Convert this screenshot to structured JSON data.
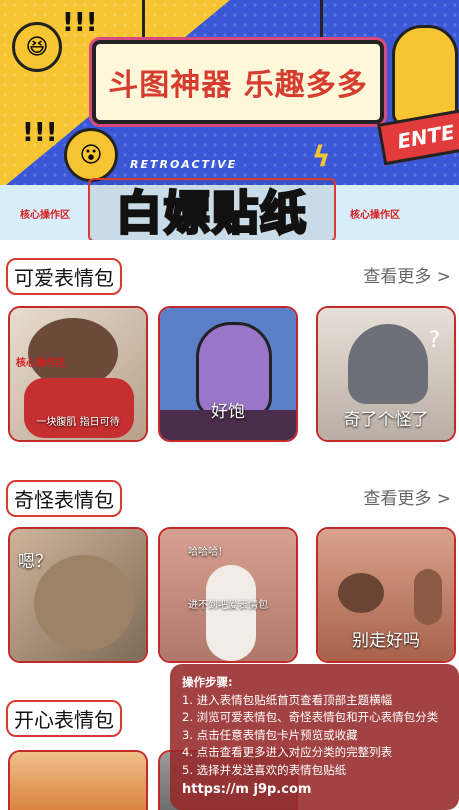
{
  "banner": {
    "sign_text": "斗图神器 乐趣多多",
    "retro_text": "RETROACTIVE",
    "enter_text": "ENTE",
    "bang_top": "!!!",
    "bang_left": "!!!",
    "hero_title": "白嫖贴纸",
    "core_label_left": "核心操作区",
    "core_label_right": "核心操作区"
  },
  "sections": [
    {
      "title": "可爱表情包",
      "more": "查看更多 >",
      "cards": [
        {
          "caption": "一块腹肌 指日可待",
          "overlay": "核心操作区",
          "bg": "#c9b8a8"
        },
        {
          "caption": "好饱",
          "bg": "#5b7fc9"
        },
        {
          "caption": "奇了个怪了",
          "bg": "#d8cfc6"
        }
      ]
    },
    {
      "title": "奇怪表情包",
      "more": "查看更多 >",
      "cards": [
        {
          "caption": "嗯？",
          "bg": "#a88c70"
        },
        {
          "caption": "进不到吧爱表情包",
          "top_text": "哈哈哈！",
          "bg": "#c98f80"
        },
        {
          "caption": "别走好吗",
          "bg": "#c98670"
        }
      ]
    },
    {
      "title": "开心表情包",
      "cards": [
        {
          "bg": "#e0a060"
        },
        {
          "bg": "#888"
        }
      ]
    }
  ],
  "steps": {
    "title": "操作步骤:",
    "items": [
      "1. 进入表情包贴纸首页查看顶部主题横幅",
      "2. 浏览可爱表情包、奇怪表情包和开心表情包分类",
      "3. 点击任意表情包卡片预览或收藏",
      "4. 点击查看更多进入对应分类的完整列表",
      "5. 选择并发送喜欢的表情包贴纸"
    ],
    "url": "https://m j9p.com"
  }
}
